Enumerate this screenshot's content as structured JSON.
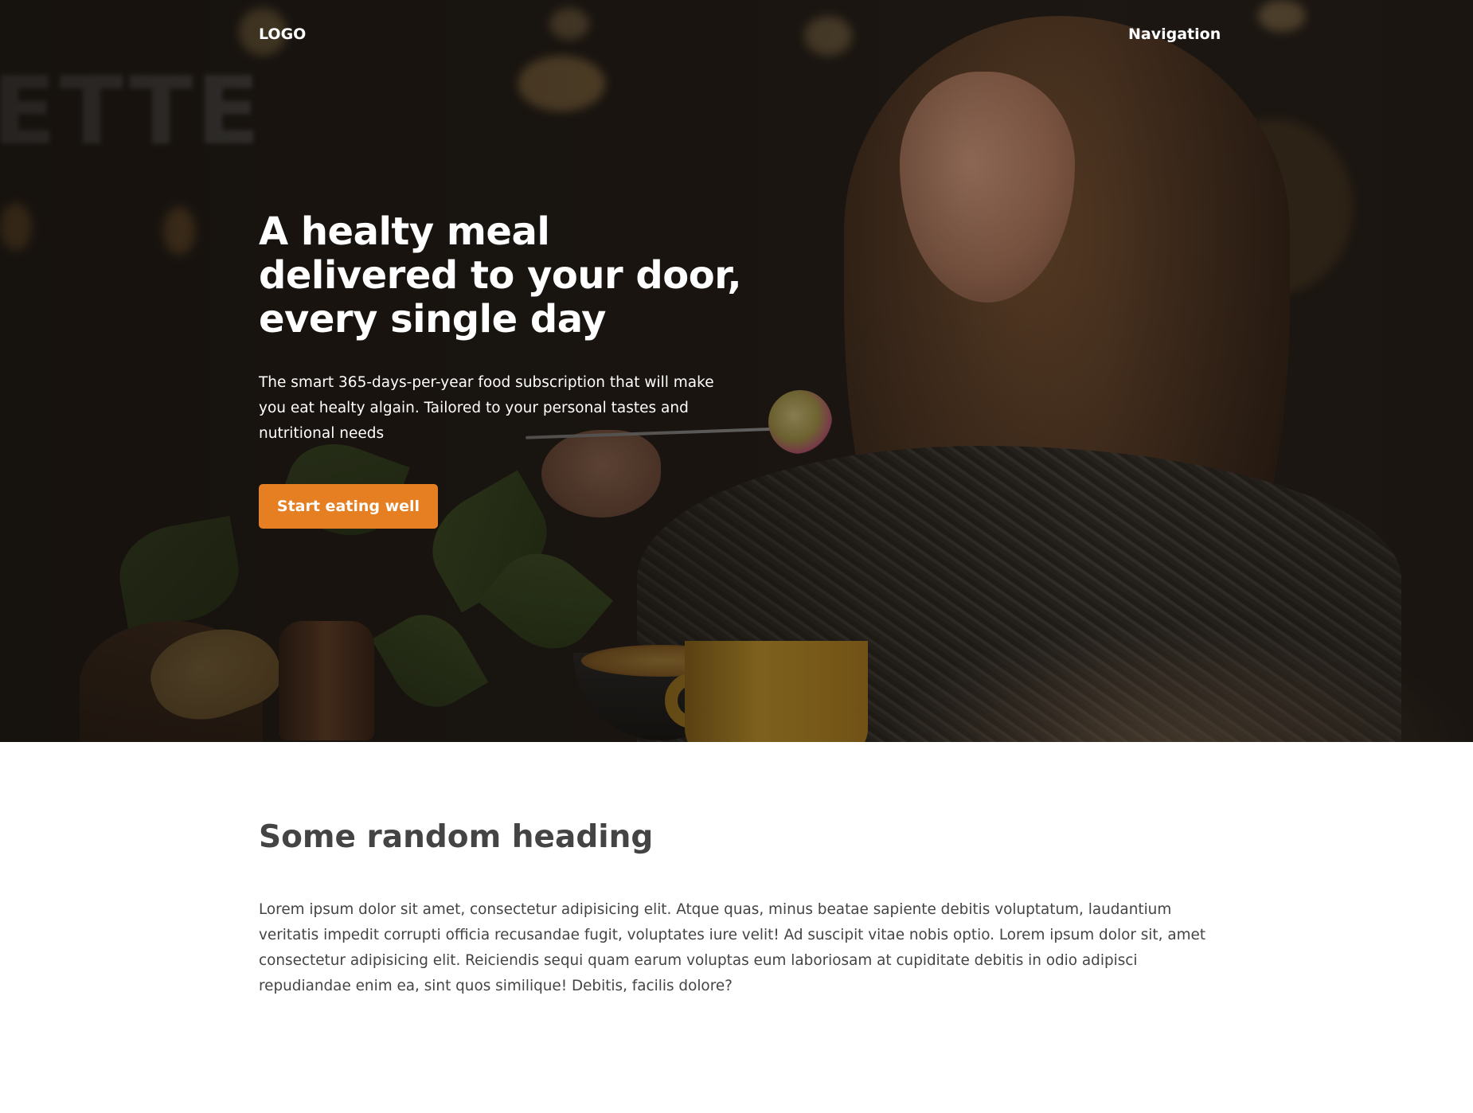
{
  "header": {
    "logo": "LOGO",
    "navigation": "Navigation"
  },
  "hero": {
    "title": "A healty meal delivered to your door, every single day",
    "text": "The smart 365-days-per-year food subscription that will make you eat healty algain. Tailored to your personal tastes and nutritional needs",
    "cta_label": "Start eating well",
    "accent_color": "#e67e22"
  },
  "content": {
    "heading": "Some random heading",
    "paragraph": "Lorem ipsum dolor sit amet, consectetur adipisicing elit. Atque quas, minus beatae sapiente debitis voluptatum, laudantium veritatis impedit corrupti officia recusandae fugit, voluptates iure velit! Ad suscipit vitae nobis optio. Lorem ipsum dolor sit, amet consectetur adipisicing elit. Reiciendis sequi quam earum voluptas eum laboriosam at cupiditate debitis in odio adipisci repudiandae enim ea, sint quos similique! Debitis, facilis dolore?"
  },
  "colors": {
    "text": "#444444",
    "hero_text": "#ffffff",
    "background": "#ffffff"
  }
}
